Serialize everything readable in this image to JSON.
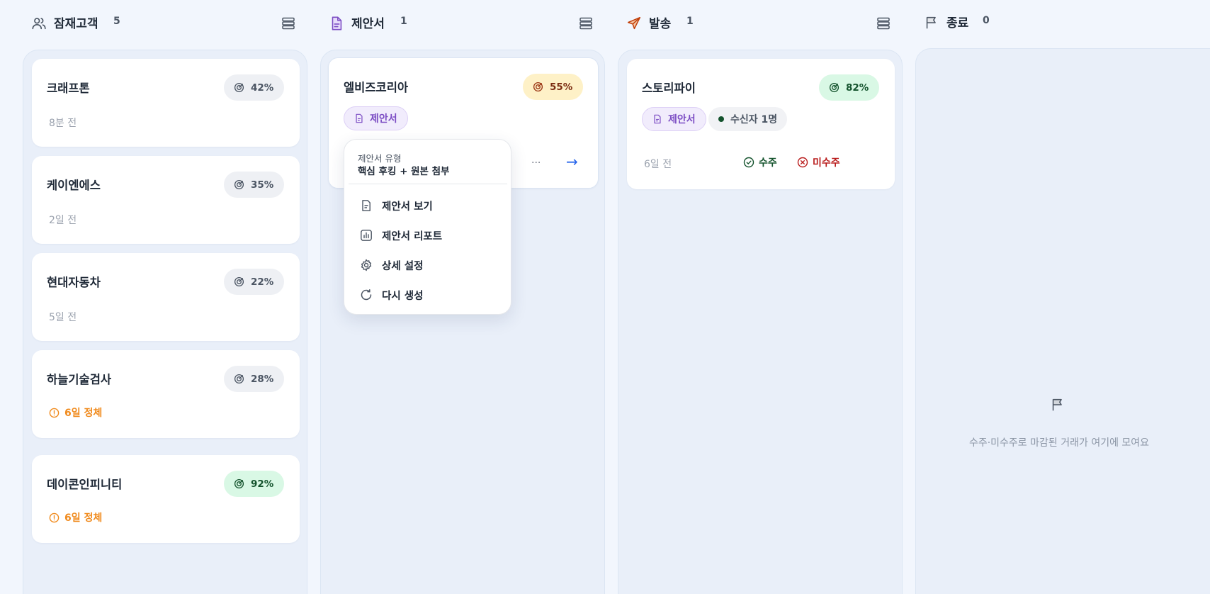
{
  "columns": [
    {
      "title": "잠재고객",
      "count": "5",
      "icon": "users-icon",
      "color": "#4b5563"
    },
    {
      "title": "제안서",
      "count": "1",
      "icon": "document-icon",
      "color": "#7c4dc4"
    },
    {
      "title": "발송",
      "count": "1",
      "icon": "send-icon",
      "color": "#c2410c"
    },
    {
      "title": "종료",
      "count": "0",
      "icon": "flag-icon",
      "color": "#4b5563"
    }
  ],
  "prospects": [
    {
      "name": "크래프톤",
      "score": "42%",
      "time": "8분 전"
    },
    {
      "name": "케이엔에스",
      "score": "35%",
      "time": "2일 전"
    },
    {
      "name": "현대자동차",
      "score": "22%",
      "time": "5일 전"
    },
    {
      "name": "하늘기술검사",
      "score": "28%",
      "stall": "6일 정체"
    },
    {
      "name": "데이콘인피니티",
      "score": "92%",
      "stall": "6일 정체"
    }
  ],
  "proposal_card": {
    "name": "엘비즈코리아",
    "score": "55%",
    "tag": "제안서",
    "more": "···",
    "arrow": "→"
  },
  "proposal_menu": {
    "caption": "제안서 유형",
    "type": "핵심 후킹 + 원본 첨부",
    "items": [
      "제안서 보기",
      "제안서 리포트",
      "상세 설정",
      "다시 생성"
    ]
  },
  "sent_card": {
    "name": "스토리파이",
    "score": "82%",
    "tag": "제안서",
    "recipients": "수신자 1명",
    "time": "6일 전",
    "won": "수주",
    "lost": "미수주"
  },
  "closed_empty": {
    "text": "수주·미수주로 마감된 거래가 여기에 모여요"
  },
  "colors": {
    "accent_purple": "#7c4dc4",
    "success_green": "#14532d",
    "danger_red": "#b91c1c",
    "warning_orange": "#f08a1c",
    "link_blue": "#2563eb"
  }
}
